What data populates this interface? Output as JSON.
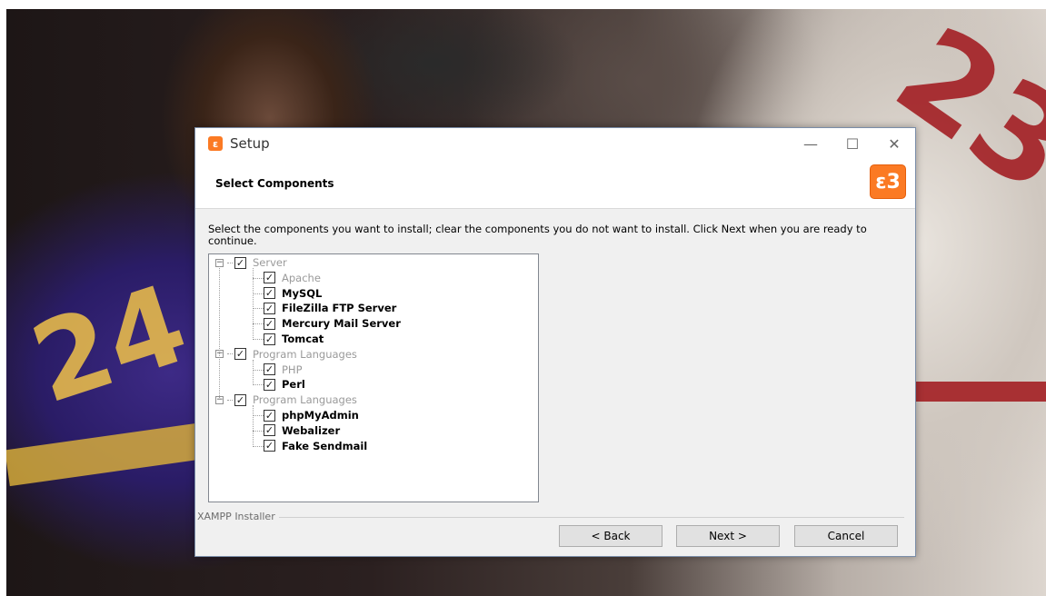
{
  "window": {
    "title": "Setup",
    "icon": "xampp-icon",
    "controls": {
      "minimize": "—",
      "maximize": "☐",
      "close": "✕"
    }
  },
  "header": {
    "title": "Select Components",
    "logo_glyph": "Ꮛ"
  },
  "description": "Select the components you want to install; clear the components you do not want to install. Click Next when you are ready to continue.",
  "tree": [
    {
      "label": "Server",
      "checked": true,
      "disabled": true,
      "group": true
    },
    {
      "label": "Apache",
      "checked": true,
      "disabled": true
    },
    {
      "label": "MySQL",
      "checked": true
    },
    {
      "label": "FileZilla FTP Server",
      "checked": true
    },
    {
      "label": "Mercury Mail Server",
      "checked": true
    },
    {
      "label": "Tomcat",
      "checked": true
    },
    {
      "label": "Program Languages",
      "checked": true,
      "disabled": true,
      "group": true
    },
    {
      "label": "PHP",
      "checked": true,
      "disabled": true
    },
    {
      "label": "Perl",
      "checked": true
    },
    {
      "label": "Program Languages",
      "checked": true,
      "disabled": true,
      "group": true
    },
    {
      "label": "phpMyAdmin",
      "checked": true
    },
    {
      "label": "Webalizer",
      "checked": true
    },
    {
      "label": "Fake Sendmail",
      "checked": true
    }
  ],
  "footer": {
    "label": "XAMPP Installer",
    "back": "< Back",
    "next": "Next >",
    "cancel": "Cancel"
  },
  "colors": {
    "accent": "#fb7a24",
    "window_bg": "#f0f0f0"
  }
}
